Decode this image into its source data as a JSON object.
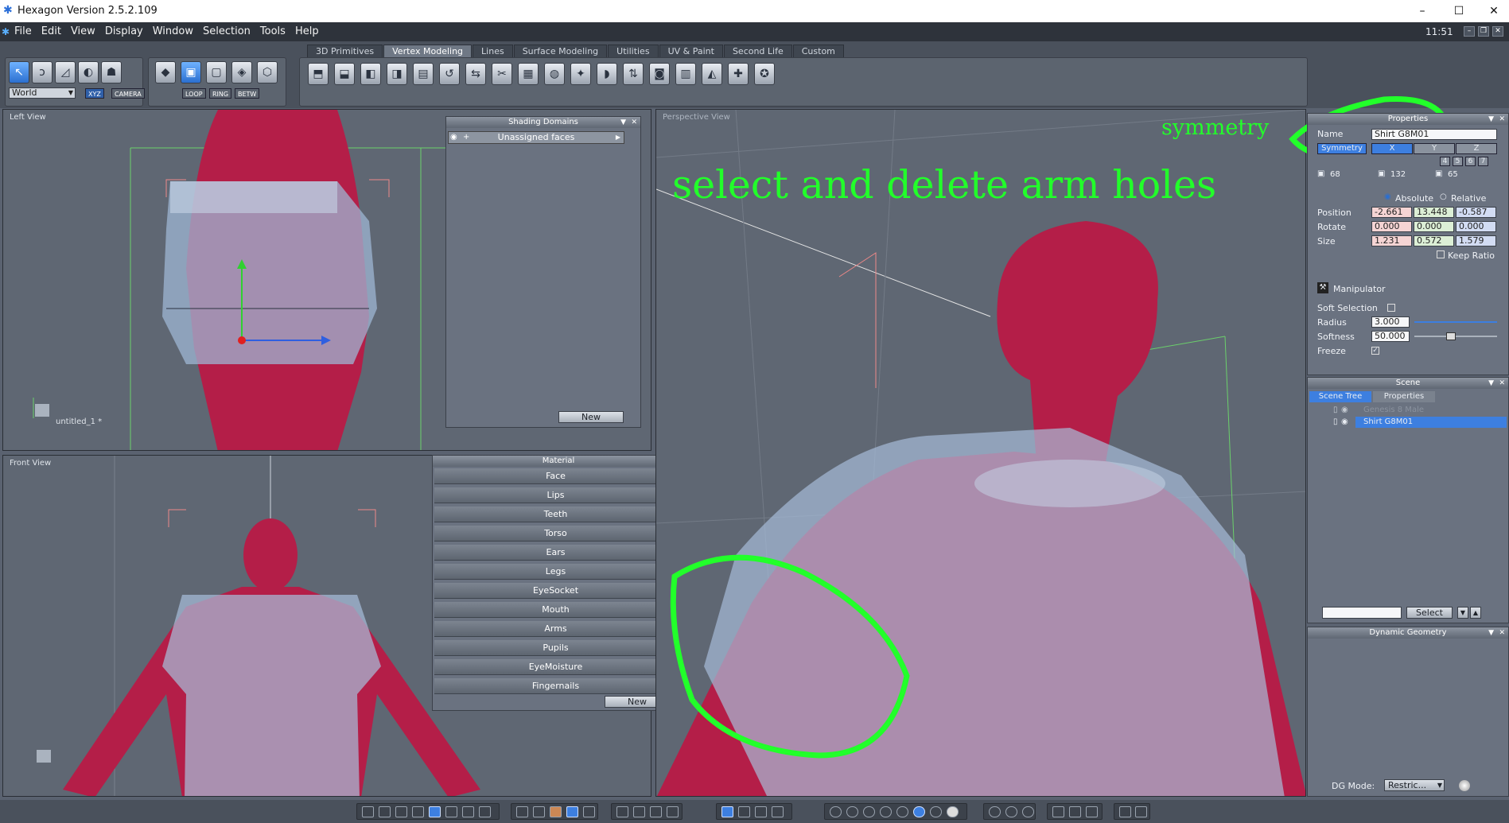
{
  "window": {
    "title": "Hexagon Version 2.5.2.109",
    "min": "–",
    "max": "☐",
    "close": "✕"
  },
  "menubar": {
    "items": [
      "File",
      "Edit",
      "View",
      "Display",
      "Window",
      "Selection",
      "Tools",
      "Help"
    ],
    "clock": "11:51"
  },
  "toolbar": {
    "tabs": [
      "3D Primitives",
      "Vertex Modeling",
      "Lines",
      "Surface Modeling",
      "Utilities",
      "UV & Paint",
      "Second Life",
      "Custom"
    ],
    "active_tab": "Vertex Modeling",
    "coord_space": "World",
    "xyz_label": "XYZ",
    "camera_label": "CAMERA",
    "loop_label": "LOOP",
    "ring_label": "RING",
    "betw_label": "BETW"
  },
  "viewports": {
    "left": {
      "label": "Left View",
      "scene_name": "untitled_1 *"
    },
    "front": {
      "label": "Front View"
    },
    "perspective": {
      "label": "Perspective View"
    }
  },
  "shading_domains": {
    "title": "Shading Domains",
    "item": "Unassigned faces",
    "new_button": "New"
  },
  "material": {
    "title": "Material",
    "items": [
      "Face",
      "Lips",
      "Teeth",
      "Torso",
      "Ears",
      "Legs",
      "EyeSocket",
      "Mouth",
      "Arms",
      "Pupils",
      "EyeMoisture",
      "Fingernails"
    ],
    "new_button": "New"
  },
  "properties": {
    "title": "Properties",
    "name_label": "Name",
    "name_value": "Shirt G8M01",
    "symmetry_label": "Symmetry",
    "axes": [
      "X",
      "Y",
      "Z"
    ],
    "slots": [
      "4",
      "5",
      "6",
      "7"
    ],
    "counts": [
      "68",
      "132",
      "65"
    ],
    "absolute_label": "Absolute",
    "relative_label": "Relative",
    "position_label": "Position",
    "position": [
      "-2.661",
      "13.448",
      "-0.587"
    ],
    "rotate_label": "Rotate",
    "rotate": [
      "0.000",
      "0.000",
      "0.000"
    ],
    "size_label": "Size",
    "size": [
      "1.231",
      "0.572",
      "1.579"
    ],
    "keep_ratio_label": "Keep Ratio",
    "manipulator_label": "Manipulator",
    "soft_selection_label": "Soft Selection",
    "radius_label": "Radius",
    "radius": "3.000",
    "softness_label": "Softness",
    "softness": "50.000",
    "freeze_label": "Freeze"
  },
  "scene": {
    "title": "Scene",
    "tabs": [
      "Scene Tree",
      "Properties"
    ],
    "items": [
      "Genesis 8 Male",
      "Shirt G8M01"
    ],
    "select_button": "Select"
  },
  "dynamic_geometry": {
    "title": "Dynamic Geometry",
    "dg_mode_label": "DG Mode:",
    "dg_mode_value": "Restric..."
  },
  "annotations": {
    "main": "select and delete arm holes",
    "symmetry": "symmetry"
  },
  "colors": {
    "annotation_green": "#22ff2a",
    "selection_blue": "#3d7fe0",
    "skin_red": "#b01c45",
    "shirt_blue": "#8fa9c9"
  }
}
